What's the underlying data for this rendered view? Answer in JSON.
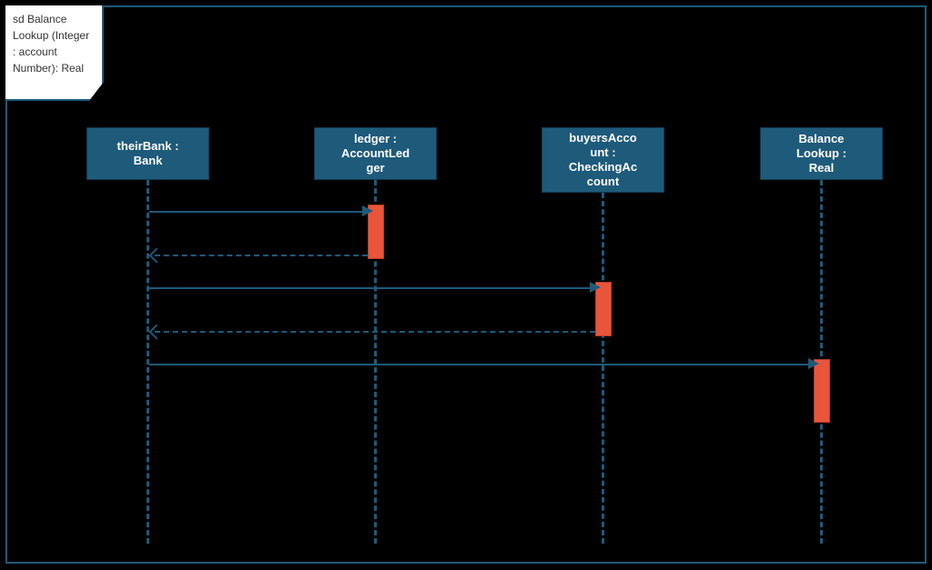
{
  "frame": {
    "title": "sd Balance\nLookup\n(Integer :\naccount\nNumber): Real"
  },
  "lifelines": [
    {
      "label": "theirBank :\nBank"
    },
    {
      "label": "ledger :\nAccountLed\nger"
    },
    {
      "label": "buyersAcco\nunt :\nCheckingAc\ncount"
    },
    {
      "label": "Balance\nLookup :\nReal"
    }
  ]
}
